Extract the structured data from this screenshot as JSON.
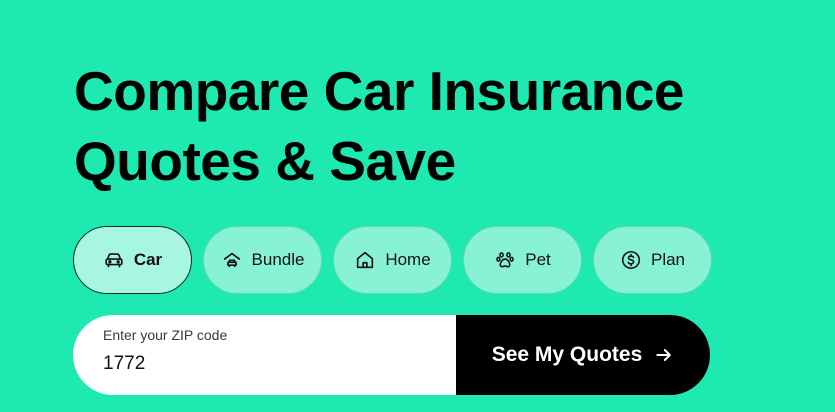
{
  "hero": {
    "title_line1": "Compare Car Insurance",
    "title_line2": "Quotes & Save"
  },
  "tabs": [
    {
      "label": "Car",
      "icon": "car-icon",
      "active": true
    },
    {
      "label": "Bundle",
      "icon": "house-car-icon",
      "active": false
    },
    {
      "label": "Home",
      "icon": "home-icon",
      "active": false
    },
    {
      "label": "Pet",
      "icon": "paw-icon",
      "active": false
    },
    {
      "label": "Plan",
      "icon": "dollar-coin-icon",
      "active": false
    }
  ],
  "form": {
    "zip_label": "Enter your ZIP code",
    "zip_value": "1772",
    "submit_label": "See My Quotes",
    "submit_icon": "arrow-right-icon"
  },
  "colors": {
    "background": "#1de9b0",
    "tab_background": "#88f2d4",
    "active_tab_background": "#a7f6df",
    "button_background": "#000000",
    "button_text": "#ffffff"
  }
}
